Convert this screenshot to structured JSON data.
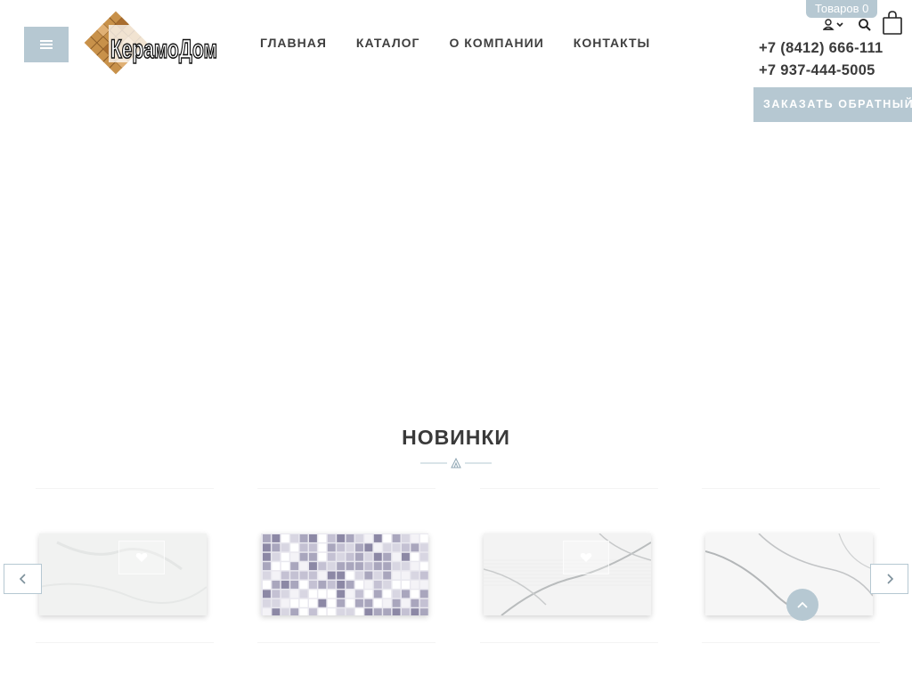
{
  "header": {
    "logo_text": "КерамоДом",
    "nav": [
      {
        "label": "ГЛАВНАЯ"
      },
      {
        "label": "КАТАЛОГ"
      },
      {
        "label": "О КОМПАНИИ"
      },
      {
        "label": "КОНТАКТЫ"
      }
    ],
    "cart_badge": "Товаров 0",
    "phones": [
      "+7 (8412) 666-111",
      "+7 937-444-5005"
    ],
    "callback_label": "ЗАКАЗАТЬ ОБРАТНЫЙ ЗВОНОК"
  },
  "section": {
    "title": "НОВИНКИ"
  },
  "products": [
    {
      "pattern": "marble-light",
      "has_fav": true
    },
    {
      "pattern": "mosaic-grey",
      "has_fav": false
    },
    {
      "pattern": "marble-veins",
      "has_fav": true
    },
    {
      "pattern": "marble-white",
      "has_fav": false
    }
  ],
  "icons": {
    "menu": "hamburger-icon",
    "user": "user-icon",
    "search": "search-icon",
    "cart": "shopping-bag-icon",
    "prev": "chevron-left-icon",
    "next": "chevron-right-icon",
    "top": "chevron-up-icon"
  },
  "colors": {
    "accent": "#b6c8d2",
    "text": "#3a3a3a"
  }
}
